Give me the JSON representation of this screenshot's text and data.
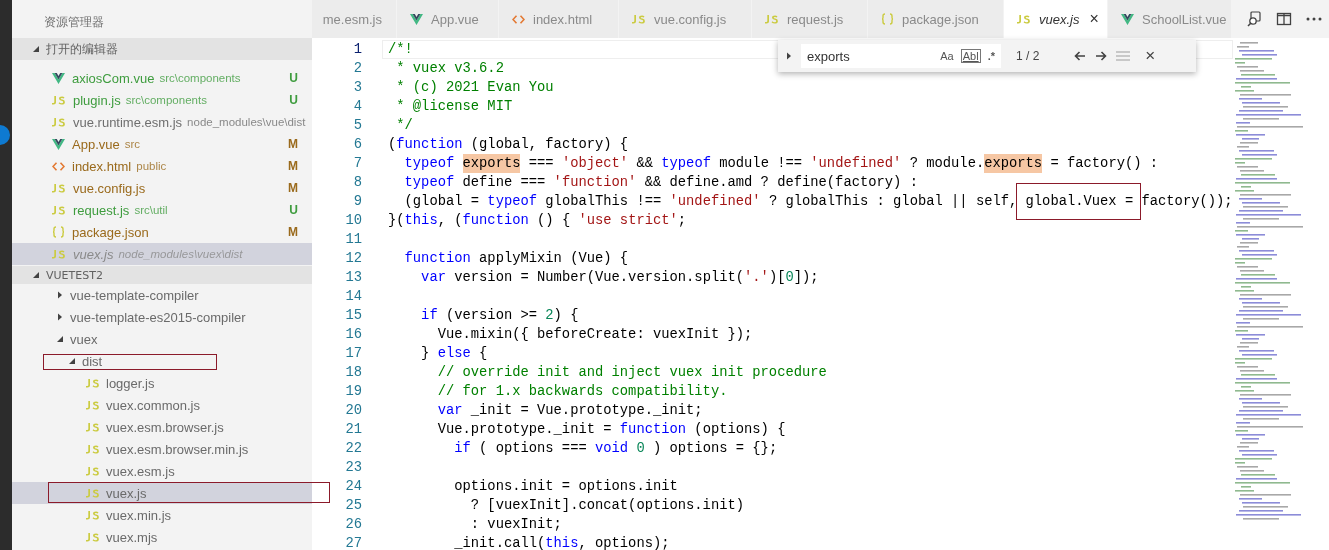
{
  "sidebar": {
    "title": "资源管理器",
    "open_editors": {
      "label": "打开的编辑器",
      "expanded": true,
      "items": [
        {
          "kind": "vue",
          "name": "axiosCom.vue",
          "description": "src\\components",
          "badge": "U",
          "color": "#3e9c3e",
          "selected": false,
          "preview": false
        },
        {
          "kind": "js",
          "name": "plugin.js",
          "description": "src\\components",
          "badge": "U",
          "color": "#3e9c3e",
          "selected": false,
          "preview": false
        },
        {
          "kind": "js",
          "name": "vue.runtime.esm.js",
          "description": "node_modules\\vue\\dist",
          "color": "#6e6e6e",
          "selected": false,
          "preview": false
        },
        {
          "kind": "vue",
          "name": "App.vue",
          "description": "src",
          "badge": "M",
          "color": "#9a6a1c",
          "selected": false,
          "preview": false
        },
        {
          "kind": "html",
          "name": "index.html",
          "description": "public",
          "badge": "M",
          "color": "#9a6a1c",
          "selected": false,
          "preview": false
        },
        {
          "kind": "js",
          "name": "vue.config.js",
          "badge": "M",
          "color": "#9a6a1c",
          "selected": false,
          "preview": false
        },
        {
          "kind": "js",
          "name": "request.js",
          "description": "src\\util",
          "badge": "U",
          "color": "#3e9c3e",
          "selected": false,
          "preview": false
        },
        {
          "kind": "json",
          "name": "package.json",
          "badge": "M",
          "color": "#9a6a1c",
          "selected": false,
          "preview": false
        },
        {
          "kind": "js",
          "name": "vuex.js",
          "description": "node_modules\\vuex\\dist",
          "color": "#8a8a8a",
          "selected": true,
          "preview": true
        }
      ]
    },
    "project": {
      "label": "VUETEST2",
      "expanded": true,
      "items": [
        {
          "name": "vue-template-compiler",
          "kind": "folder",
          "expanded": false,
          "selected": false,
          "boxed": false
        },
        {
          "name": "vue-template-es2015-compiler",
          "kind": "folder",
          "expanded": false,
          "selected": false,
          "boxed": false
        },
        {
          "name": "vuex",
          "kind": "folder",
          "expanded": true,
          "selected": false,
          "boxed": false,
          "children": [
            {
              "name": "dist",
              "kind": "folder",
              "expanded": true,
              "selected": false,
              "boxed": true,
              "children": [
                {
                  "name": "logger.js",
                  "kind": "js",
                  "selected": false,
                  "boxed": false
                },
                {
                  "name": "vuex.common.js",
                  "kind": "js",
                  "selected": false,
                  "boxed": false
                },
                {
                  "name": "vuex.esm.browser.js",
                  "kind": "js",
                  "selected": false,
                  "boxed": false
                },
                {
                  "name": "vuex.esm.browser.min.js",
                  "kind": "js",
                  "selected": false,
                  "boxed": false
                },
                {
                  "name": "vuex.esm.js",
                  "kind": "js",
                  "selected": false,
                  "boxed": false
                },
                {
                  "name": "vuex.js",
                  "kind": "js",
                  "selected": true,
                  "boxed": true
                },
                {
                  "name": "vuex.min.js",
                  "kind": "js",
                  "selected": false,
                  "boxed": false
                },
                {
                  "name": "vuex.mjs",
                  "kind": "js",
                  "selected": false,
                  "boxed": false
                }
              ]
            }
          ]
        }
      ]
    }
  },
  "tabs": [
    {
      "label": "me.esm.js",
      "selected": false,
      "preview": false
    },
    {
      "label": "App.vue",
      "kind": "vue",
      "selected": false,
      "preview": false
    },
    {
      "label": "index.html",
      "kind": "html",
      "selected": false,
      "preview": false
    },
    {
      "label": "vue.config.js",
      "kind": "js",
      "selected": false,
      "preview": false
    },
    {
      "label": "request.js",
      "kind": "js",
      "selected": false,
      "preview": false
    },
    {
      "label": "package.json",
      "kind": "json",
      "selected": false,
      "preview": false
    },
    {
      "label": "vuex.js",
      "kind": "js",
      "selected": true,
      "preview": true,
      "close": "×"
    },
    {
      "label": "SchoolList.vue",
      "kind": "vue",
      "selected": false,
      "preview": false
    }
  ],
  "find": {
    "value": "exports",
    "match_case": "Aa",
    "whole_word": "Abl",
    "regex": ".*",
    "count": "1 / 2",
    "close": "×"
  },
  "editor": {
    "lines": [
      {
        "number": "1",
        "current": true,
        "tokens": [
          {
            "text": "/*!",
            "kind": "comment"
          }
        ]
      },
      {
        "number": "2",
        "current": false,
        "tokens": [
          {
            "text": " * vuex v3.6.2",
            "kind": "comment"
          }
        ]
      },
      {
        "number": "3",
        "current": false,
        "tokens": [
          {
            "text": " * (c) 2021 Evan You",
            "kind": "comment"
          }
        ]
      },
      {
        "number": "4",
        "current": false,
        "tokens": [
          {
            "text": " * @license MIT",
            "kind": "comment"
          }
        ]
      },
      {
        "number": "5",
        "current": false,
        "tokens": [
          {
            "text": " */",
            "kind": "comment"
          }
        ]
      },
      {
        "number": "6",
        "current": false,
        "tokens": [
          {
            "text": "(",
            "kind": "plain"
          },
          {
            "text": "function",
            "kind": "keyword"
          },
          {
            "text": " (global, factory) {",
            "kind": "plain"
          }
        ]
      },
      {
        "number": "7",
        "current": false,
        "tokens": [
          {
            "text": "  typeof ",
            "kind": "keyword"
          },
          {
            "text": "exports",
            "kind": "match"
          },
          {
            "text": " === ",
            "kind": "plain"
          },
          {
            "text": "'object'",
            "kind": "string"
          },
          {
            "text": " && ",
            "kind": "plain"
          },
          {
            "text": "typeof",
            "kind": "keyword"
          },
          {
            "text": " module !== ",
            "kind": "plain"
          },
          {
            "text": "'undefined'",
            "kind": "string"
          },
          {
            "text": " ? module.",
            "kind": "plain"
          },
          {
            "text": "exports",
            "kind": "match"
          },
          {
            "text": " = factory() :",
            "kind": "plain"
          }
        ]
      },
      {
        "number": "8",
        "current": false,
        "tokens": [
          {
            "text": "  typeof",
            "kind": "keyword"
          },
          {
            "text": " define === ",
            "kind": "plain"
          },
          {
            "text": "'function'",
            "kind": "string"
          },
          {
            "text": " && define.amd ? define(factory) :",
            "kind": "plain"
          }
        ]
      },
      {
        "number": "9",
        "current": false,
        "tokens": [
          {
            "text": "  (global = ",
            "kind": "plain"
          },
          {
            "text": "typeof",
            "kind": "keyword"
          },
          {
            "text": " globalThis !== ",
            "kind": "plain"
          },
          {
            "text": "'undefined'",
            "kind": "string"
          },
          {
            "text": " ? globalThis : global || self, ",
            "kind": "plain"
          },
          {
            "text": "global.Vuex =",
            "kind": "plain",
            "boxed": true
          },
          {
            "text": " factory());",
            "kind": "plain"
          }
        ]
      },
      {
        "number": "10",
        "current": false,
        "tokens": [
          {
            "text": "}(",
            "kind": "plain"
          },
          {
            "text": "this",
            "kind": "keyword"
          },
          {
            "text": ", (",
            "kind": "plain"
          },
          {
            "text": "function",
            "kind": "keyword"
          },
          {
            "text": " () { ",
            "kind": "plain"
          },
          {
            "text": "'use strict'",
            "kind": "string"
          },
          {
            "text": ";",
            "kind": "plain"
          }
        ]
      },
      {
        "number": "11",
        "current": false
      },
      {
        "number": "12",
        "current": false,
        "tokens": [
          {
            "text": "  function",
            "kind": "keyword"
          },
          {
            "text": " applyMixin (Vue) {",
            "kind": "plain"
          }
        ]
      },
      {
        "number": "13",
        "current": false,
        "tokens": [
          {
            "text": "    var",
            "kind": "keyword"
          },
          {
            "text": " version = Number(Vue.version.split(",
            "kind": "plain"
          },
          {
            "text": "'.'",
            "kind": "string"
          },
          {
            "text": ")[",
            "kind": "plain"
          },
          {
            "text": "0",
            "kind": "number"
          },
          {
            "text": "]);",
            "kind": "plain"
          }
        ]
      },
      {
        "number": "14",
        "current": false
      },
      {
        "number": "15",
        "current": false,
        "tokens": [
          {
            "text": "    if",
            "kind": "keyword"
          },
          {
            "text": " (version >= ",
            "kind": "plain"
          },
          {
            "text": "2",
            "kind": "number"
          },
          {
            "text": ") {",
            "kind": "plain"
          }
        ]
      },
      {
        "number": "16",
        "current": false,
        "tokens": [
          {
            "text": "      Vue.mixin({ beforeCreate: vuexInit });",
            "kind": "plain"
          }
        ]
      },
      {
        "number": "17",
        "current": false,
        "tokens": [
          {
            "text": "    } ",
            "kind": "plain"
          },
          {
            "text": "else",
            "kind": "keyword"
          },
          {
            "text": " {",
            "kind": "plain"
          }
        ]
      },
      {
        "number": "18",
        "current": false,
        "tokens": [
          {
            "text": "      // override init and inject vuex init procedure",
            "kind": "comment"
          }
        ]
      },
      {
        "number": "19",
        "current": false,
        "tokens": [
          {
            "text": "      // for 1.x backwards compatibility.",
            "kind": "comment"
          }
        ]
      },
      {
        "number": "20",
        "current": false,
        "tokens": [
          {
            "text": "      var",
            "kind": "keyword"
          },
          {
            "text": " _init = Vue.prototype._init;",
            "kind": "plain"
          }
        ]
      },
      {
        "number": "21",
        "current": false,
        "tokens": [
          {
            "text": "      Vue.prototype._init = ",
            "kind": "plain"
          },
          {
            "text": "function",
            "kind": "keyword"
          },
          {
            "text": " (options) {",
            "kind": "plain"
          }
        ]
      },
      {
        "number": "22",
        "current": false,
        "tokens": [
          {
            "text": "        if",
            "kind": "keyword"
          },
          {
            "text": " ( options === ",
            "kind": "plain"
          },
          {
            "text": "void",
            "kind": "keyword"
          },
          {
            "text": " 0",
            "kind": "number"
          },
          {
            "text": " ) options = {};",
            "kind": "plain"
          }
        ]
      },
      {
        "number": "23",
        "current": false
      },
      {
        "number": "24",
        "current": false,
        "tokens": [
          {
            "text": "        options.init = options.init",
            "kind": "plain"
          }
        ]
      },
      {
        "number": "25",
        "current": false,
        "tokens": [
          {
            "text": "          ? [vuexInit].concat(options.init)",
            "kind": "plain"
          }
        ]
      },
      {
        "number": "26",
        "current": false,
        "tokens": [
          {
            "text": "          : vuexInit;",
            "kind": "plain"
          }
        ]
      },
      {
        "number": "27",
        "current": false,
        "tokens": [
          {
            "text": "        _init.call(",
            "kind": "plain"
          },
          {
            "text": "this",
            "kind": "keyword"
          },
          {
            "text": ", options);",
            "kind": "plain"
          }
        ]
      }
    ]
  }
}
